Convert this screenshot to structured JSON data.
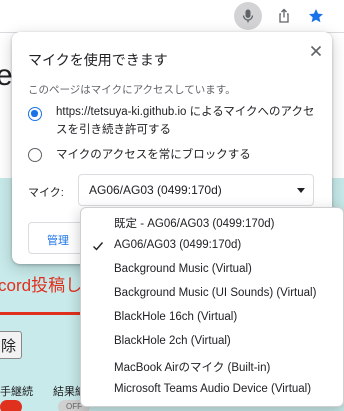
{
  "toolbar": {
    "mic_icon": "microphone-icon",
    "share_icon": "share-icon",
    "bookmark_icon": "star-icon",
    "accent_color": "#1a73e8"
  },
  "page": {
    "heading_fragment": "e",
    "red_text": "cord投稿した",
    "delete_button_label": "除",
    "label_1": "手継続",
    "label_2": "結果編",
    "toggle_label": "OFF",
    "band_color": "#c8eaea",
    "red_color": "#e0301e"
  },
  "popup": {
    "title": "マイクを使用できます",
    "close_icon": "close-icon",
    "description": "このページはマイクにアクセスしています。",
    "allow_option": "https://tetsuya-ki.github.io によるマイクへのアクセスを引き続き許可する",
    "block_option": "マイクのアクセスを常にブロックする",
    "allow_selected": true,
    "mic_label": "マイク:",
    "mic_selected": "AG06/AG03 (0499:170d)",
    "manage_label": "管理"
  },
  "dropdown": {
    "items": [
      {
        "label": "既定 - AG06/AG03 (0499:170d)",
        "checked": false
      },
      {
        "label": "AG06/AG03 (0499:170d)",
        "checked": true
      },
      {
        "label": "Background Music (Virtual)",
        "checked": false
      },
      {
        "label": "Background Music (UI Sounds) (Virtual)",
        "checked": false
      },
      {
        "label": "BlackHole 16ch (Virtual)",
        "checked": false
      },
      {
        "label": "BlackHole 2ch (Virtual)",
        "checked": false
      },
      {
        "label": "MacBook Airのマイク (Built-in)",
        "checked": false
      },
      {
        "label": "Microsoft Teams Audio Device (Virtual)",
        "checked": false
      }
    ]
  }
}
